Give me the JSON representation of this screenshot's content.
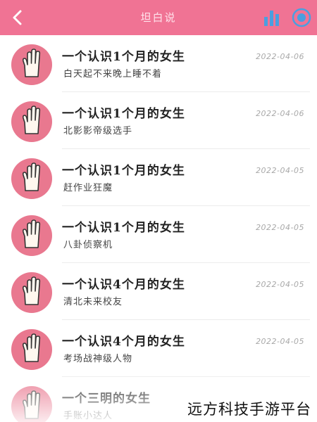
{
  "header": {
    "title": "坦白说",
    "back_icon": "chevron-left-icon",
    "stats_icon": "bar-chart-icon",
    "record_icon": "record-circle-icon",
    "bg_color": "#f07394"
  },
  "messages": [
    {
      "title": "一个认识1个月的女生",
      "subtitle": "白天起不来晚上睡不着",
      "date": "2022-04-06"
    },
    {
      "title": "一个认识1个月的女生",
      "subtitle": "北影影帝级选手",
      "date": "2022-04-06"
    },
    {
      "title": "一个认识1个月的女生",
      "subtitle": "赶作业狂魔",
      "date": "2022-04-05"
    },
    {
      "title": "一个认识1个月的女生",
      "subtitle": "八卦侦察机",
      "date": "2022-04-05"
    },
    {
      "title": "一个认识4个月的女生",
      "subtitle": "清北未来校友",
      "date": "2022-04-05"
    },
    {
      "title": "一个认识4个月的女生",
      "subtitle": "考场战神级人物",
      "date": "2022-04-05"
    },
    {
      "title": "一个三明的女生",
      "subtitle": "手账小达人",
      "date": ""
    }
  ],
  "avatar_icon": "hand-icon",
  "watermark": "远方科技手游平台"
}
